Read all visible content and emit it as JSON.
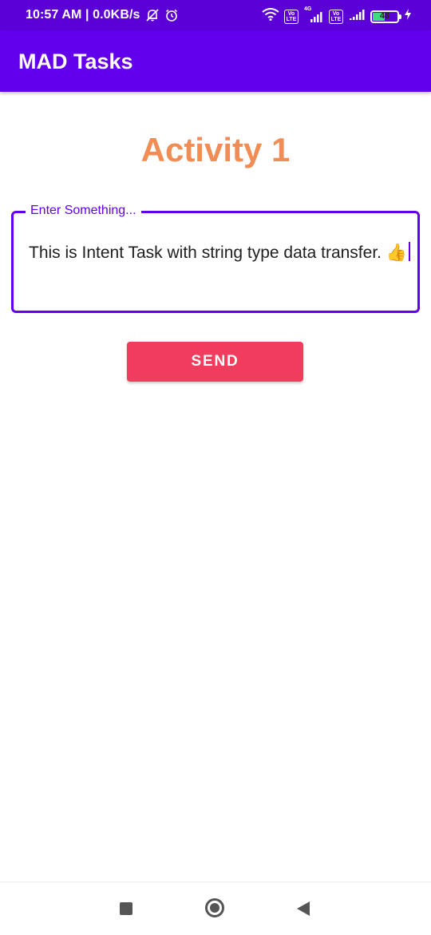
{
  "status_bar": {
    "time_speed": "10:57 AM | 0.0KB/s",
    "volte_label": "Vo LTE",
    "network_type": "4G",
    "battery_level": "46",
    "icons": [
      "notification-muted-icon",
      "alarm-icon",
      "wifi-icon",
      "volte-icon",
      "signal-icon",
      "volte-icon",
      "signal-icon",
      "battery-icon",
      "charging-icon"
    ]
  },
  "app_bar": {
    "title": "MAD Tasks"
  },
  "main": {
    "heading": "Activity 1",
    "input": {
      "label": "Enter Something...",
      "value": "This is Intent Task with string type data transfer. 👍"
    },
    "send_label": "SEND"
  },
  "nav_bar": {
    "icons": [
      "recents-icon",
      "home-icon",
      "back-icon"
    ]
  },
  "colors": {
    "status_bar": "#5c00d8",
    "app_bar": "#6200ee",
    "heading": "#f08c54",
    "button": "#f23c5d",
    "accent": "#6200ee"
  }
}
